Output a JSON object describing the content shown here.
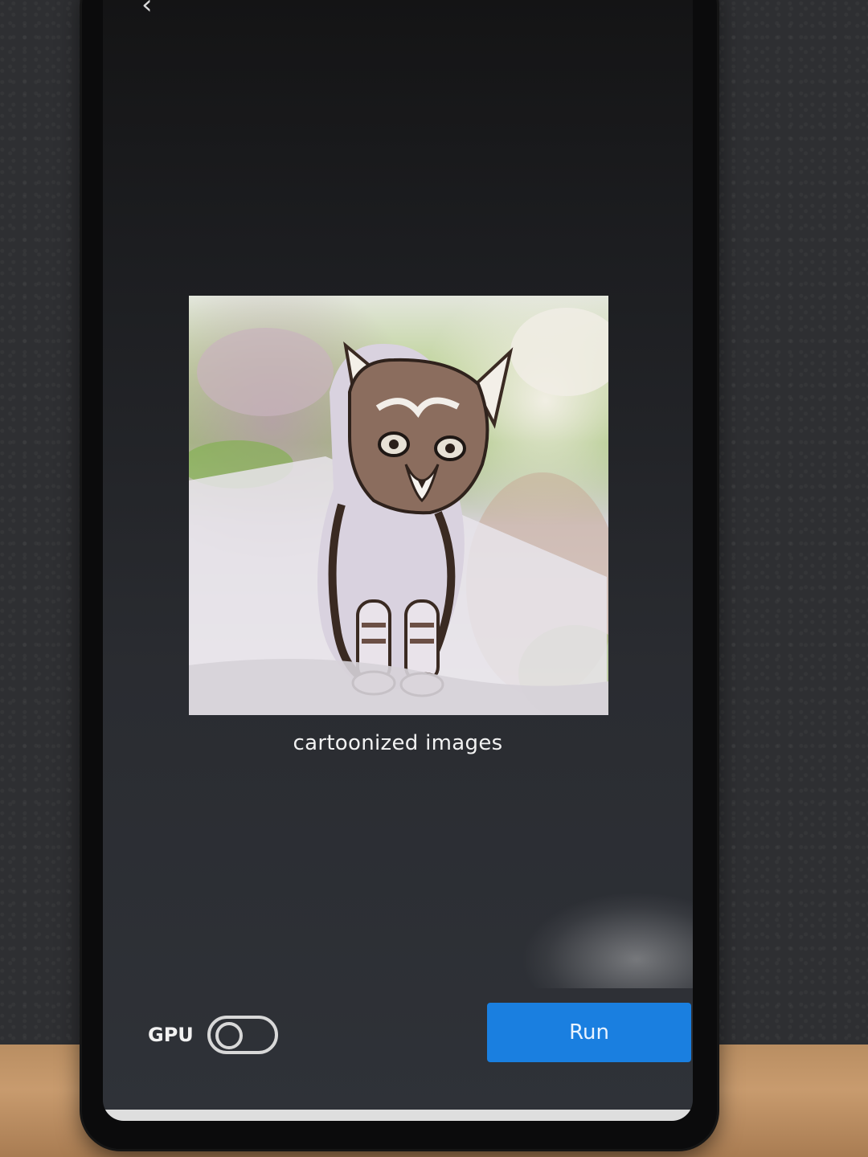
{
  "screen": {
    "caption": "cartoonized images",
    "result_image_alt": "cartoonized kitten walking toward camera"
  },
  "controls": {
    "gpu_label": "GPU",
    "gpu_enabled": false,
    "run_label": "Run"
  },
  "colors": {
    "run_button": "#1a7fe0",
    "screen_background": "#2f3238",
    "text": "#f2f2f2"
  },
  "icons": {
    "back": "chevron-left-icon"
  }
}
